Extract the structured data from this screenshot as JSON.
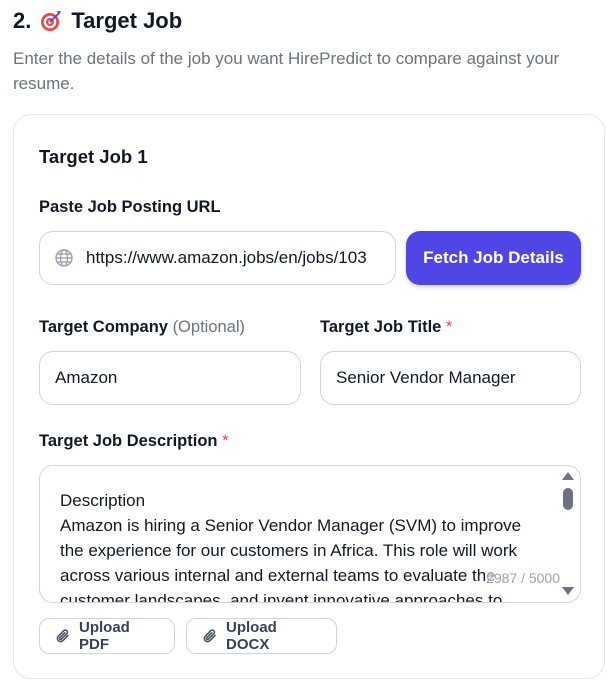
{
  "section": {
    "title": "2. 🎯 Target Job",
    "number": "2.",
    "heading": "Target Job",
    "icon": "target-icon",
    "description": "Enter the details of the job you want HirePredict to compare against your resume."
  },
  "card": {
    "title": "Target Job 1",
    "url": {
      "label": "Paste Job Posting URL",
      "value": "https://www.amazon.jobs/en/jobs/103",
      "icon": "globe-icon"
    },
    "fetch_button": "Fetch Job Details",
    "company": {
      "label": "Target Company",
      "optional": "(Optional)",
      "value": "Amazon"
    },
    "job_title": {
      "label": "Target Job Title",
      "required_mark": "*",
      "value": "Senior Vendor Manager"
    },
    "description": {
      "label": "Target Job Description",
      "required_mark": "*",
      "value": "Description\nAmazon is hiring a Senior Vendor Manager (SVM) to improve the experience for our customers in Africa. This role will work across various internal and external teams to evaluate the customer landscapes, and invent innovative approaches to",
      "char_count": "2987 / 5000"
    },
    "upload_pdf": "Upload PDF",
    "upload_docx": "Upload DOCX"
  },
  "colors": {
    "accent": "#4f46e5",
    "required": "#ef4444",
    "muted": "#6b7280"
  }
}
